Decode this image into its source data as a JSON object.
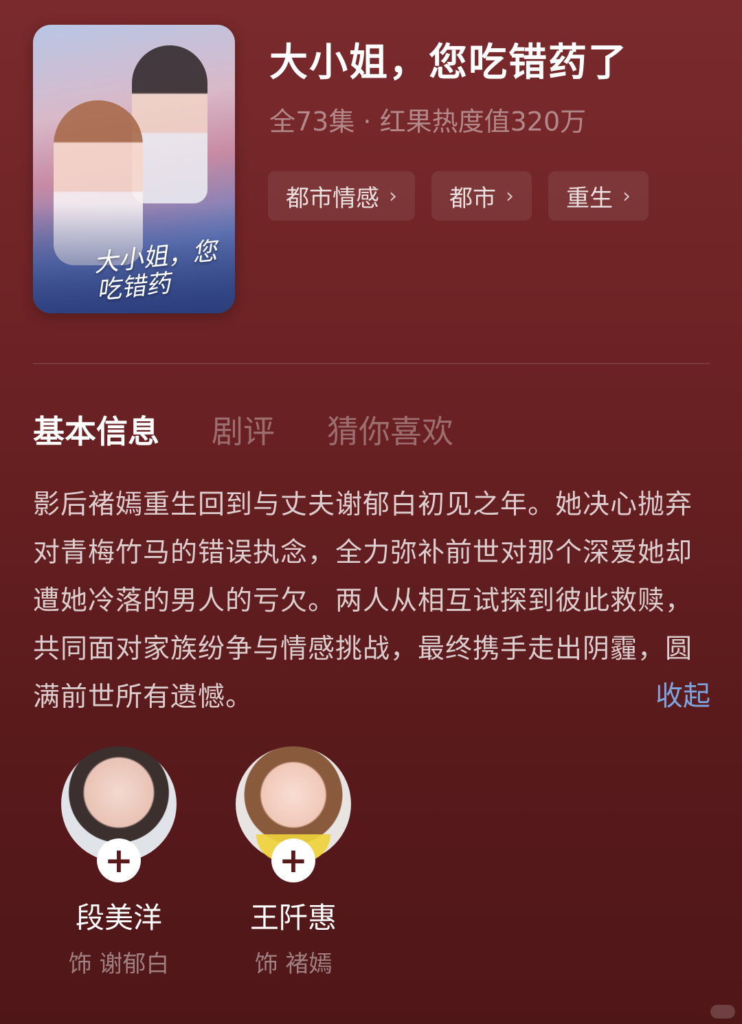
{
  "header": {
    "title": "大小姐，您吃错药了",
    "meta": "全73集 · 红果热度值320万"
  },
  "poster": {
    "title": "大小姐，您吃错药"
  },
  "tags": [
    {
      "label": "都市情感"
    },
    {
      "label": "都市"
    },
    {
      "label": "重生"
    }
  ],
  "tabs": [
    {
      "label": "基本信息",
      "active": true
    },
    {
      "label": "剧评",
      "active": false
    },
    {
      "label": "猜你喜欢",
      "active": false
    }
  ],
  "description": {
    "text": "影后褚嫣重生回到与丈夫谢郁白初见之年。她决心抛弃对青梅竹马的错误执念，全力弥补前世对那个深爱她却遭她冷落的男人的亏欠。两人从相互试探到彼此救赎，共同面对家族纷争与情感挑战，最终携手走出阴霾，圆满前世所有遗憾。",
    "collapse_label": "收起"
  },
  "cast": [
    {
      "name": "段美洋",
      "role": "饰 谢郁白"
    },
    {
      "name": "王阡惠",
      "role": "饰 褚嫣"
    }
  ],
  "colors": {
    "background": "#6c2224",
    "accent_link": "#7fa5e0"
  },
  "icons": {
    "tag_chevron": "chevron-right-icon",
    "follow": "plus-icon"
  }
}
